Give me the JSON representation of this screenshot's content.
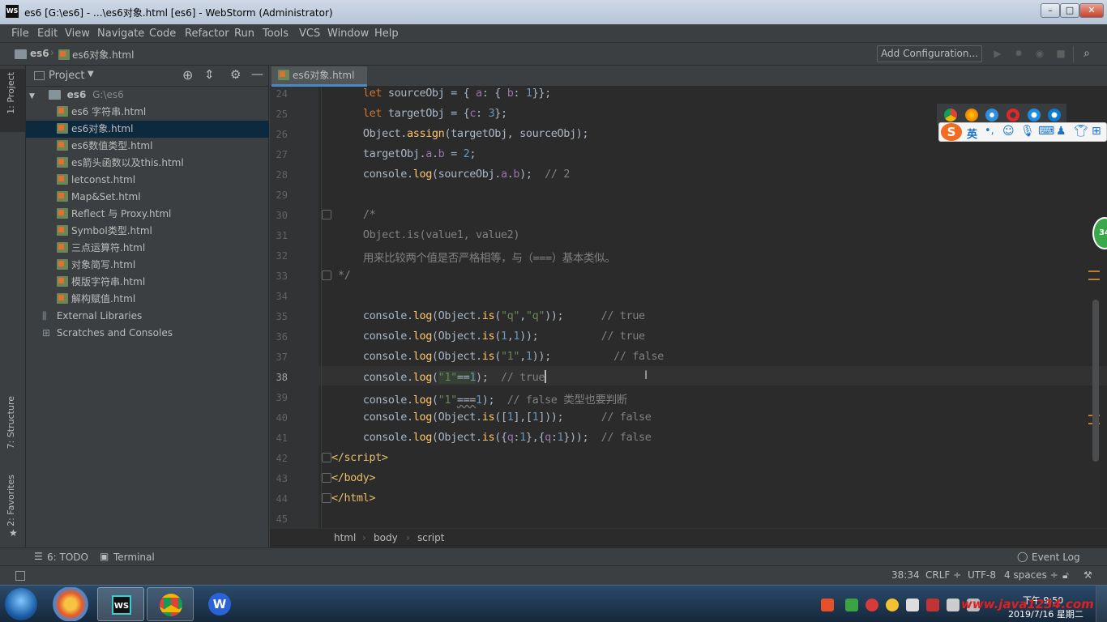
{
  "window": {
    "title": "es6 [G:\\es6] - ...\\es6对象.html [es6] - WebStorm (Administrator)",
    "app_icon": "WS",
    "controls": [
      "minimize",
      "maximize",
      "close"
    ]
  },
  "menu": [
    "File",
    "Edit",
    "View",
    "Navigate",
    "Code",
    "Refactor",
    "Run",
    "Tools",
    "VCS",
    "Window",
    "Help"
  ],
  "navbar": {
    "crumb_project": "es6",
    "crumb_file": "es6对象.html",
    "add_configuration": "Add Configuration..."
  },
  "left_tabs": {
    "project": "1: Project",
    "structure": "7: Structure",
    "favorites": "2: Favorites"
  },
  "project_panel": {
    "title": "Project",
    "root_name": "es6",
    "root_path": "G:\\es6",
    "files": [
      "es6 字符串.html",
      "es6对象.html",
      "es6数值类型.html",
      "es箭头函数以及this.html",
      "letconst.html",
      "Map&Set.html",
      "Reflect 与 Proxy.html",
      "Symbol类型.html",
      "三点运算符.html",
      "对象简写.html",
      "模版字符串.html",
      "解构赋值.html"
    ],
    "selected_index": 1,
    "external_libraries": "External Libraries",
    "scratches": "Scratches and Consoles"
  },
  "editor": {
    "active_tab": "es6对象.html",
    "current_line": 38,
    "line_numbers": [
      "24",
      "25",
      "26",
      "27",
      "28",
      "29",
      "30",
      "31",
      "32",
      "33",
      "34",
      "35",
      "36",
      "37",
      "38",
      "39",
      "40",
      "41",
      "42",
      "43",
      "44",
      "45"
    ]
  },
  "breadcrumbs": [
    "html",
    "body",
    "script"
  ],
  "bottom_tools": {
    "todo": "6: TODO",
    "terminal": "Terminal",
    "event_log": "Event Log"
  },
  "status": {
    "position": "38:34",
    "line_sep": "CRLF ÷",
    "encoding": "UTF-8",
    "indent": "4 spaces ÷"
  },
  "taskbar": {
    "clock_time": "下午 9:50",
    "clock_date": "2019/7/16 星期二",
    "watermark": "www.java1234.com"
  },
  "ime": {
    "lang": "英",
    "badge": "34"
  }
}
